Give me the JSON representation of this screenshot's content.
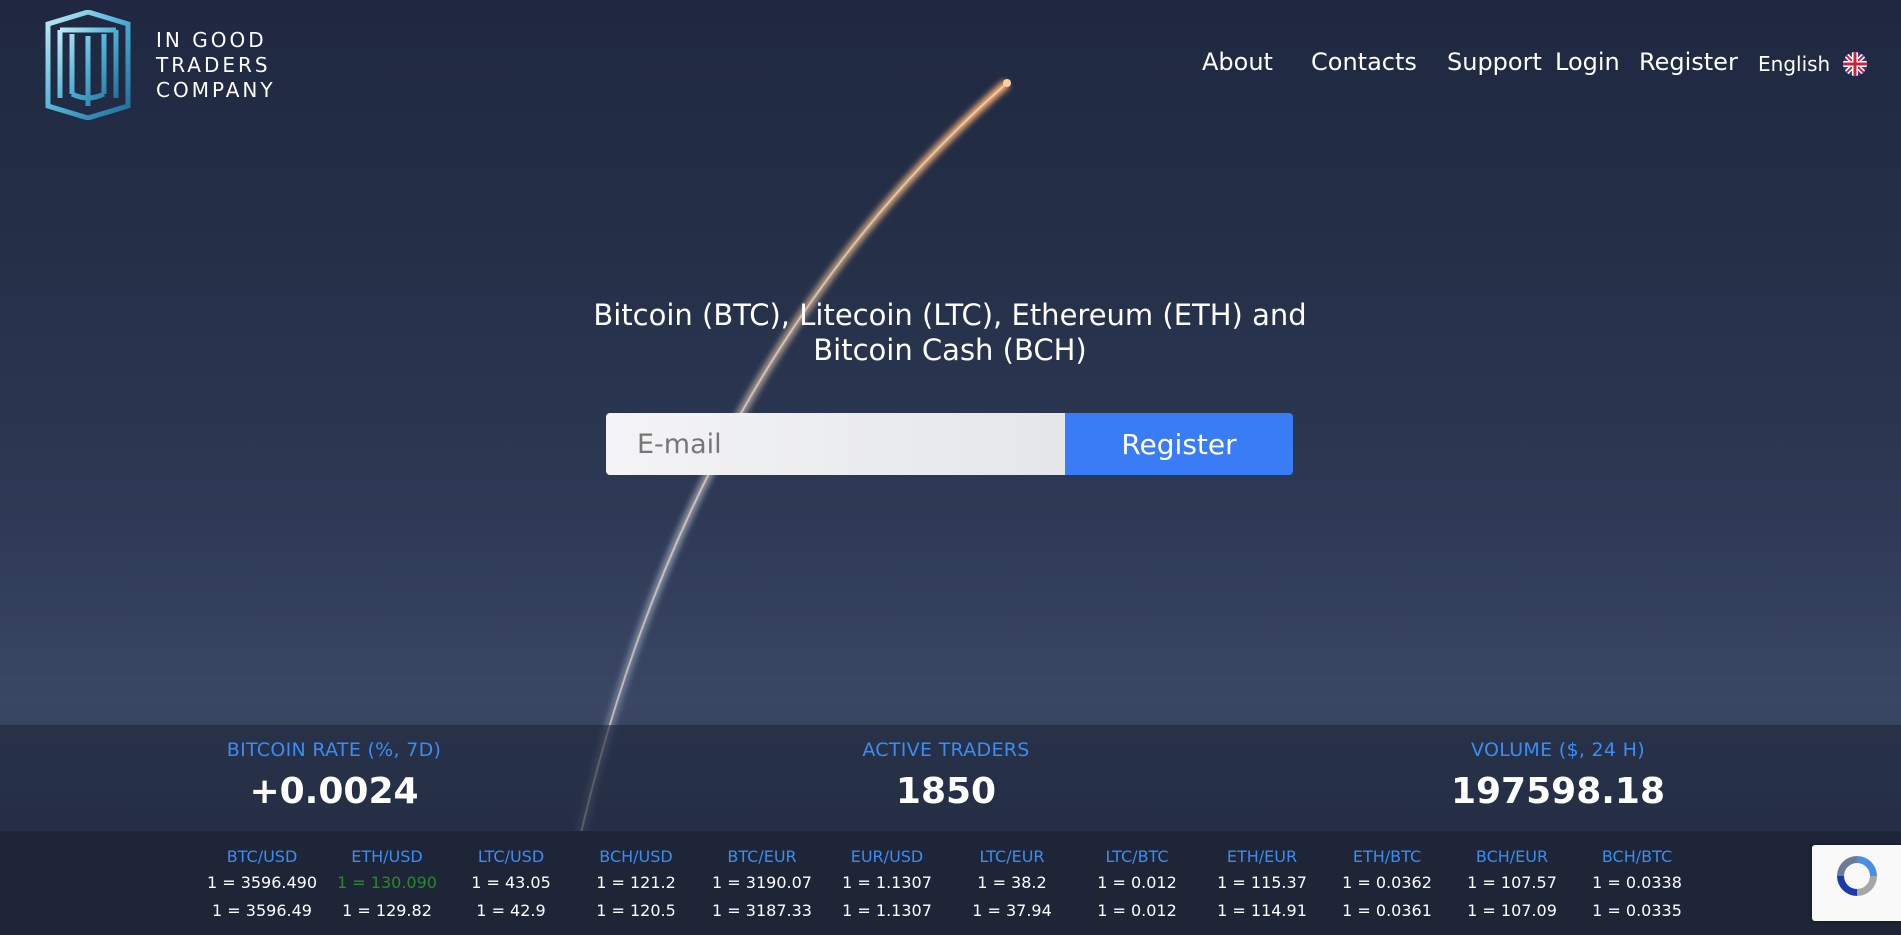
{
  "brand": {
    "line1": "IN GOOD",
    "line2": "TRADERS",
    "line3": "COMPANY"
  },
  "nav": {
    "about": "About",
    "contacts": "Contacts",
    "support": "Support",
    "login": "Login",
    "register": "Register",
    "language": "English"
  },
  "hero": {
    "title": "Bitcoin (BTC), Litecoin (LTC), Ethereum (ETH) and Bitcoin Cash (BCH)",
    "email_placeholder": "E-mail",
    "register_button": "Register"
  },
  "stats": [
    {
      "label": "BITCOIN RATE (%, 7D)",
      "value": "+0.0024"
    },
    {
      "label": "ACTIVE TRADERS",
      "value": "1850"
    },
    {
      "label": "VOLUME ($, 24 H)",
      "value": "197598.18"
    }
  ],
  "ticker": [
    {
      "pair": "BTC/USD",
      "rate1": "1 = 3596.490",
      "rate2": "1 = 3596.49",
      "rate1_up": false
    },
    {
      "pair": "ETH/USD",
      "rate1": "1 = 130.090",
      "rate2": "1 = 129.82",
      "rate1_up": true
    },
    {
      "pair": "LTC/USD",
      "rate1": "1 = 43.05",
      "rate2": "1 = 42.9",
      "rate1_up": false
    },
    {
      "pair": "BCH/USD",
      "rate1": "1 = 121.2",
      "rate2": "1 = 120.5",
      "rate1_up": false
    },
    {
      "pair": "BTC/EUR",
      "rate1": "1 = 3190.07",
      "rate2": "1 = 3187.33",
      "rate1_up": false
    },
    {
      "pair": "EUR/USD",
      "rate1": "1 = 1.1307",
      "rate2": "1 = 1.1307",
      "rate1_up": false
    },
    {
      "pair": "LTC/EUR",
      "rate1": "1 = 38.2",
      "rate2": "1 = 37.94",
      "rate1_up": false
    },
    {
      "pair": "LTC/BTC",
      "rate1": "1 = 0.012",
      "rate2": "1 = 0.012",
      "rate1_up": false
    },
    {
      "pair": "ETH/EUR",
      "rate1": "1 = 115.37",
      "rate2": "1 = 114.91",
      "rate1_up": false
    },
    {
      "pair": "ETH/BTC",
      "rate1": "1 = 0.0362",
      "rate2": "1 = 0.0361",
      "rate1_up": false
    },
    {
      "pair": "BCH/EUR",
      "rate1": "1 = 107.57",
      "rate2": "1 = 107.09",
      "rate1_up": false
    },
    {
      "pair": "BCH/BTC",
      "rate1": "1 = 0.0338",
      "rate2": "1 = 0.0335",
      "rate1_up": false
    }
  ],
  "colors": {
    "accent": "#3a8df5",
    "button": "#3a7cf6",
    "rate_up": "#2a8a2a"
  },
  "icons": {
    "logo": "ig-logo-mark",
    "flag": "uk-flag-icon",
    "captcha": "recaptcha-icon"
  }
}
